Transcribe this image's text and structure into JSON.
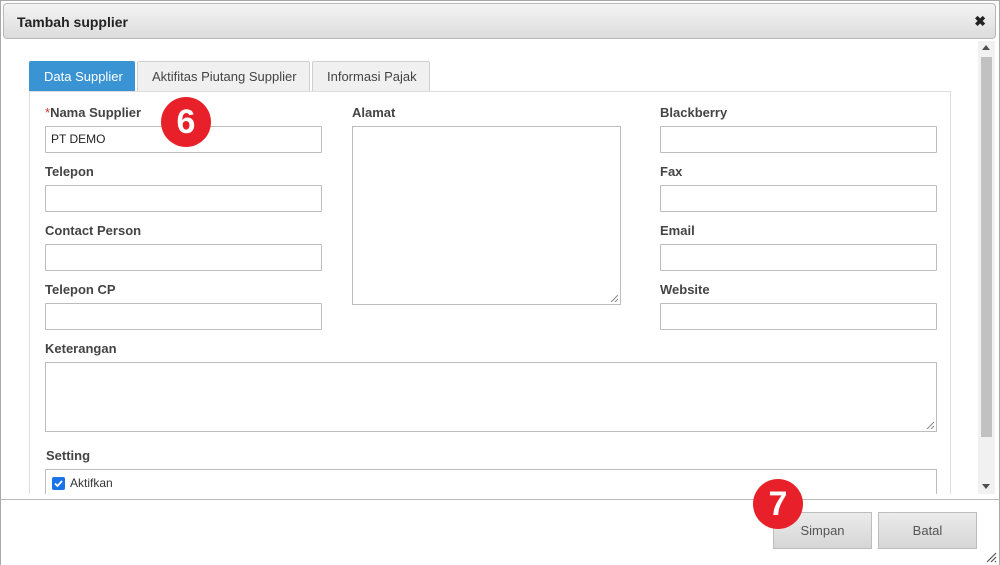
{
  "dialog": {
    "title": "Tambah supplier",
    "close_icon": "close-icon",
    "close_glyph": "✖"
  },
  "tabs": [
    {
      "label": "Data Supplier",
      "active": true
    },
    {
      "label": "Aktifitas Piutang Supplier",
      "active": false
    },
    {
      "label": "Informasi Pajak",
      "active": false
    }
  ],
  "form": {
    "nama_supplier": {
      "required_mark": "*",
      "label": "Nama Supplier",
      "value": "PT DEMO"
    },
    "telepon": {
      "label": "Telepon",
      "value": ""
    },
    "contact_person": {
      "label": "Contact Person",
      "value": ""
    },
    "telepon_cp": {
      "label": "Telepon CP",
      "value": ""
    },
    "alamat": {
      "label": "Alamat",
      "value": ""
    },
    "blackberry": {
      "label": "Blackberry",
      "value": ""
    },
    "fax": {
      "label": "Fax",
      "value": ""
    },
    "email": {
      "label": "Email",
      "value": ""
    },
    "website": {
      "label": "Website",
      "value": ""
    },
    "keterangan": {
      "label": "Keterangan",
      "value": ""
    },
    "setting": {
      "label": "Setting",
      "checkbox_label": "Aktifkan",
      "checked": true
    }
  },
  "annotations": {
    "step_6": "6",
    "step_7": "7"
  },
  "footer": {
    "save_label": "Simpan",
    "cancel_label": "Batal"
  },
  "colors": {
    "tab_active": "#3a94d4",
    "badge": "#e8202a",
    "required": "#d9302c"
  }
}
